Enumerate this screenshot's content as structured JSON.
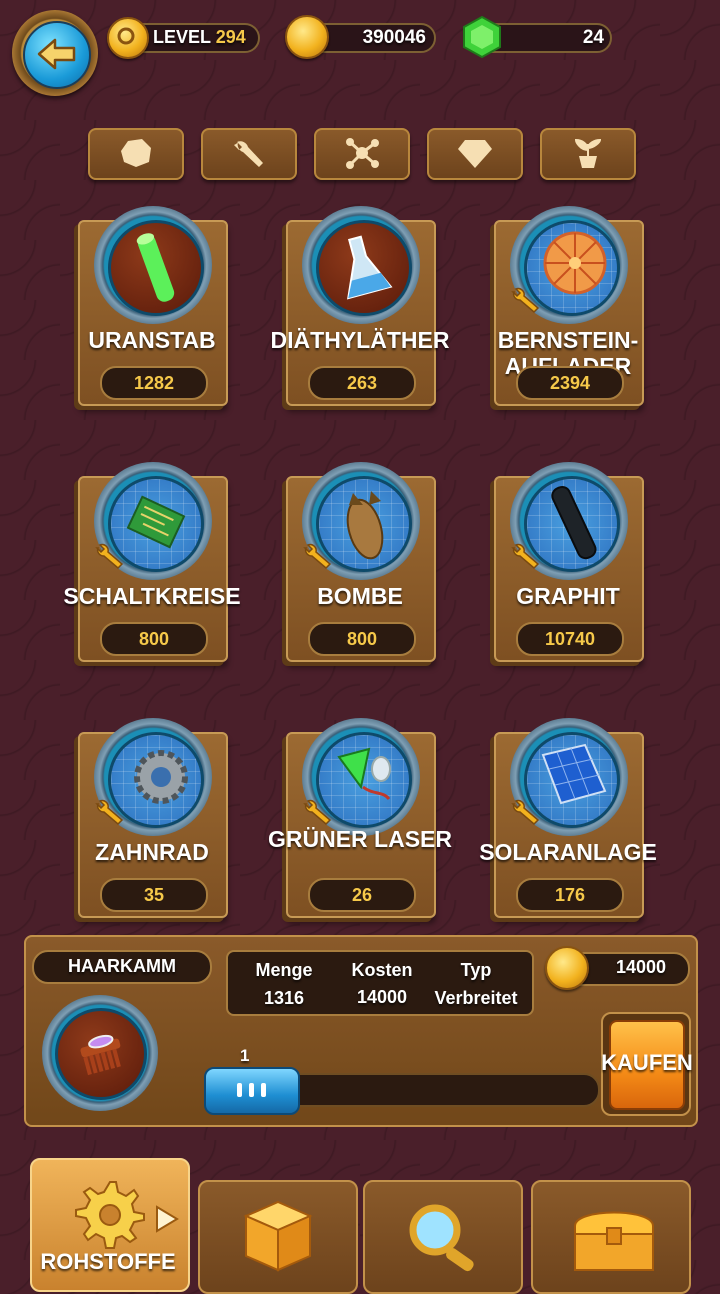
{
  "header": {
    "level_label": "LEVEL",
    "level_value": "294",
    "coins": "390046",
    "gems": "24"
  },
  "categories": [
    {
      "icon": "stone-icon"
    },
    {
      "icon": "wrench-icon"
    },
    {
      "icon": "molecule-icon"
    },
    {
      "icon": "diamond-icon"
    },
    {
      "icon": "plant-icon"
    }
  ],
  "items": [
    {
      "name": "URANSTAB",
      "count": "1282"
    },
    {
      "name": "DIÄTHYLÄTHER",
      "count": "263"
    },
    {
      "name": "BERNSTEIN-AUFLADER",
      "count": "2394"
    },
    {
      "name": "SCHALTKREISE",
      "count": "800"
    },
    {
      "name": "BOMBE",
      "count": "800"
    },
    {
      "name": "GRAPHIT",
      "count": "10740"
    },
    {
      "name": "ZAHNRAD",
      "count": "35"
    },
    {
      "name": "GRÜNER LASER",
      "count": "26"
    },
    {
      "name": "SOLARANLAGE",
      "count": "176"
    }
  ],
  "detail": {
    "name": "HAARKAMM",
    "menge_label": "Menge",
    "menge_value": "1316",
    "kosten_label": "Kosten",
    "kosten_value": "14000",
    "typ_label": "Typ",
    "typ_value": "Verbreitet",
    "price": "14000",
    "quantity": "1",
    "buy_label": "KAUFEN"
  },
  "nav": {
    "tab1_label": "ROHSTOFFE"
  },
  "colors": {
    "background": "#4a1f2a",
    "gold_text": "#f6c94a",
    "accent_blue": "#1e8ed2",
    "buy_orange": "#f48a16"
  }
}
